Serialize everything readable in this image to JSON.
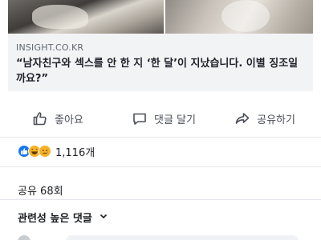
{
  "post": {
    "link_card": {
      "domain": "INSIGHT.CO.KR",
      "title": "“남자친구와 섹스를 안 한 지 ‘한 달’이 지났습니다. 이별 징조일까요?”"
    },
    "actions": {
      "like_label": "좋아요",
      "comment_label": "댓글 달기",
      "share_label": "공유하기"
    },
    "reactions": {
      "icons": [
        "like-icon",
        "haha-icon",
        "sad-icon"
      ],
      "count": "1,116개"
    },
    "share_count": "공유 68회",
    "comments": {
      "header": "관련성 높은 댓글"
    }
  },
  "colors": {
    "link_card_bg": "#f2f3f5",
    "like_blue": "#1877f2",
    "emoji_yellow": "#f7b125",
    "action_text": "#4b4f56"
  }
}
